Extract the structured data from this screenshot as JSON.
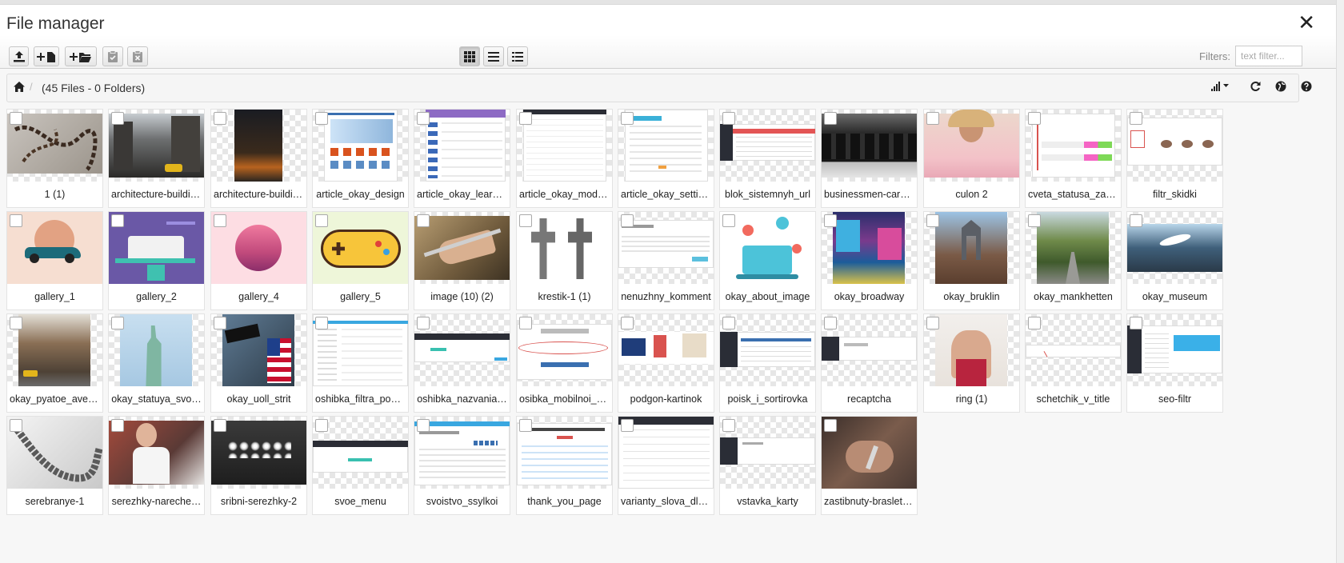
{
  "modal": {
    "title": "File manager",
    "close_glyph": "✕"
  },
  "toolbar": {
    "left_buttons": [
      "upload-icon",
      "new-file-icon",
      "new-folder-icon",
      "clipboard-check-icon",
      "clipboard-x-icon"
    ],
    "view_buttons": [
      "grid-view-icon",
      "list-view-icon",
      "columns-view-icon"
    ],
    "active_view": "grid",
    "filters_label": "Filters:",
    "filter_placeholder": "text filter..."
  },
  "navbar": {
    "separator": "/",
    "counts": "(45 Files - 0 Folders)",
    "right_icons": [
      "sort-icon",
      "refresh-icon",
      "language-icon",
      "help-icon"
    ]
  },
  "files": [
    {
      "name": "1 (1)",
      "thumb": "chain-dark"
    },
    {
      "name": "architecture-buildin…",
      "thumb": "street-city"
    },
    {
      "name": "architecture-buildin…",
      "thumb": "night-street-portrait"
    },
    {
      "name": "article_okay_design",
      "thumb": "shop-screenshot"
    },
    {
      "name": "article_okay_learni…",
      "thumb": "purple-screenshot"
    },
    {
      "name": "article_okay_module",
      "thumb": "table-screenshot"
    },
    {
      "name": "article_okay_settings",
      "thumb": "settings-screenshot"
    },
    {
      "name": "blok_sistemnyh_url",
      "thumb": "admin-dark-screenshot"
    },
    {
      "name": "businessmen-care…",
      "thumb": "businessmen-photo"
    },
    {
      "name": "culon 2",
      "thumb": "woman-pink"
    },
    {
      "name": "cveta_statusa_zak…",
      "thumb": "status-colors-screenshot"
    },
    {
      "name": "filtr_skidki",
      "thumb": "filter-screenshot"
    },
    {
      "name": "gallery_1",
      "thumb": "car-illustration"
    },
    {
      "name": "gallery_2",
      "thumb": "purple-illustration"
    },
    {
      "name": "gallery_4",
      "thumb": "pink-circle-illustration"
    },
    {
      "name": "gallery_5",
      "thumb": "gamepad-illustration"
    },
    {
      "name": "image (10) (2)",
      "thumb": "hand-photo"
    },
    {
      "name": "krestik-1 (1)",
      "thumb": "crosses-photo"
    },
    {
      "name": "nenuzhny_komment",
      "thumb": "comment-screenshot"
    },
    {
      "name": "okay_about_image",
      "thumb": "laptop-illustration"
    },
    {
      "name": "okay_broadway",
      "thumb": "broadway-photo"
    },
    {
      "name": "okay_bruklin",
      "thumb": "bridge-photo"
    },
    {
      "name": "okay_mankhetten",
      "thumb": "street-green-photo"
    },
    {
      "name": "okay_museum",
      "thumb": "museum-photo"
    },
    {
      "name": "okay_pyatoe_avenyu",
      "thumb": "avenue-photo"
    },
    {
      "name": "okay_statuya_svo…",
      "thumb": "liberty-photo"
    },
    {
      "name": "okay_uoll_strit",
      "thumb": "wallstreet-photo"
    },
    {
      "name": "oshibka_filtra_po_…",
      "thumb": "filter-error-screenshot"
    },
    {
      "name": "oshibka_nazvania…",
      "thumb": "title-error-screenshot"
    },
    {
      "name": "osibka_mobilnoi_k…",
      "thumb": "mobile-error-screenshot"
    },
    {
      "name": "podgon-kartinok",
      "thumb": "products-screenshot"
    },
    {
      "name": "poisk_i_sortirovka",
      "thumb": "search-sort-screenshot"
    },
    {
      "name": "recaptcha",
      "thumb": "recaptcha-screenshot"
    },
    {
      "name": "ring (1)",
      "thumb": "ring-photo"
    },
    {
      "name": "schetchik_v_title",
      "thumb": "counter-screenshot"
    },
    {
      "name": "seo-filtr",
      "thumb": "seo-screenshot"
    },
    {
      "name": "serebranye-1",
      "thumb": "silver-chain-photo"
    },
    {
      "name": "serezhky-nareche…",
      "thumb": "bride-photo"
    },
    {
      "name": "sribni-serezhky-2",
      "thumb": "earrings-photo"
    },
    {
      "name": "svoe_menu",
      "thumb": "menu-screenshot"
    },
    {
      "name": "svoistvo_ssylkoi",
      "thumb": "link-property-screenshot"
    },
    {
      "name": "thank_you_page",
      "thumb": "thankyou-screenshot"
    },
    {
      "name": "varianty_slova_dly…",
      "thumb": "variants-screenshot"
    },
    {
      "name": "vstavka_karty",
      "thumb": "map-insert-screenshot"
    },
    {
      "name": "zastibnuty-braslet-…",
      "thumb": "bracelet-photo"
    }
  ]
}
